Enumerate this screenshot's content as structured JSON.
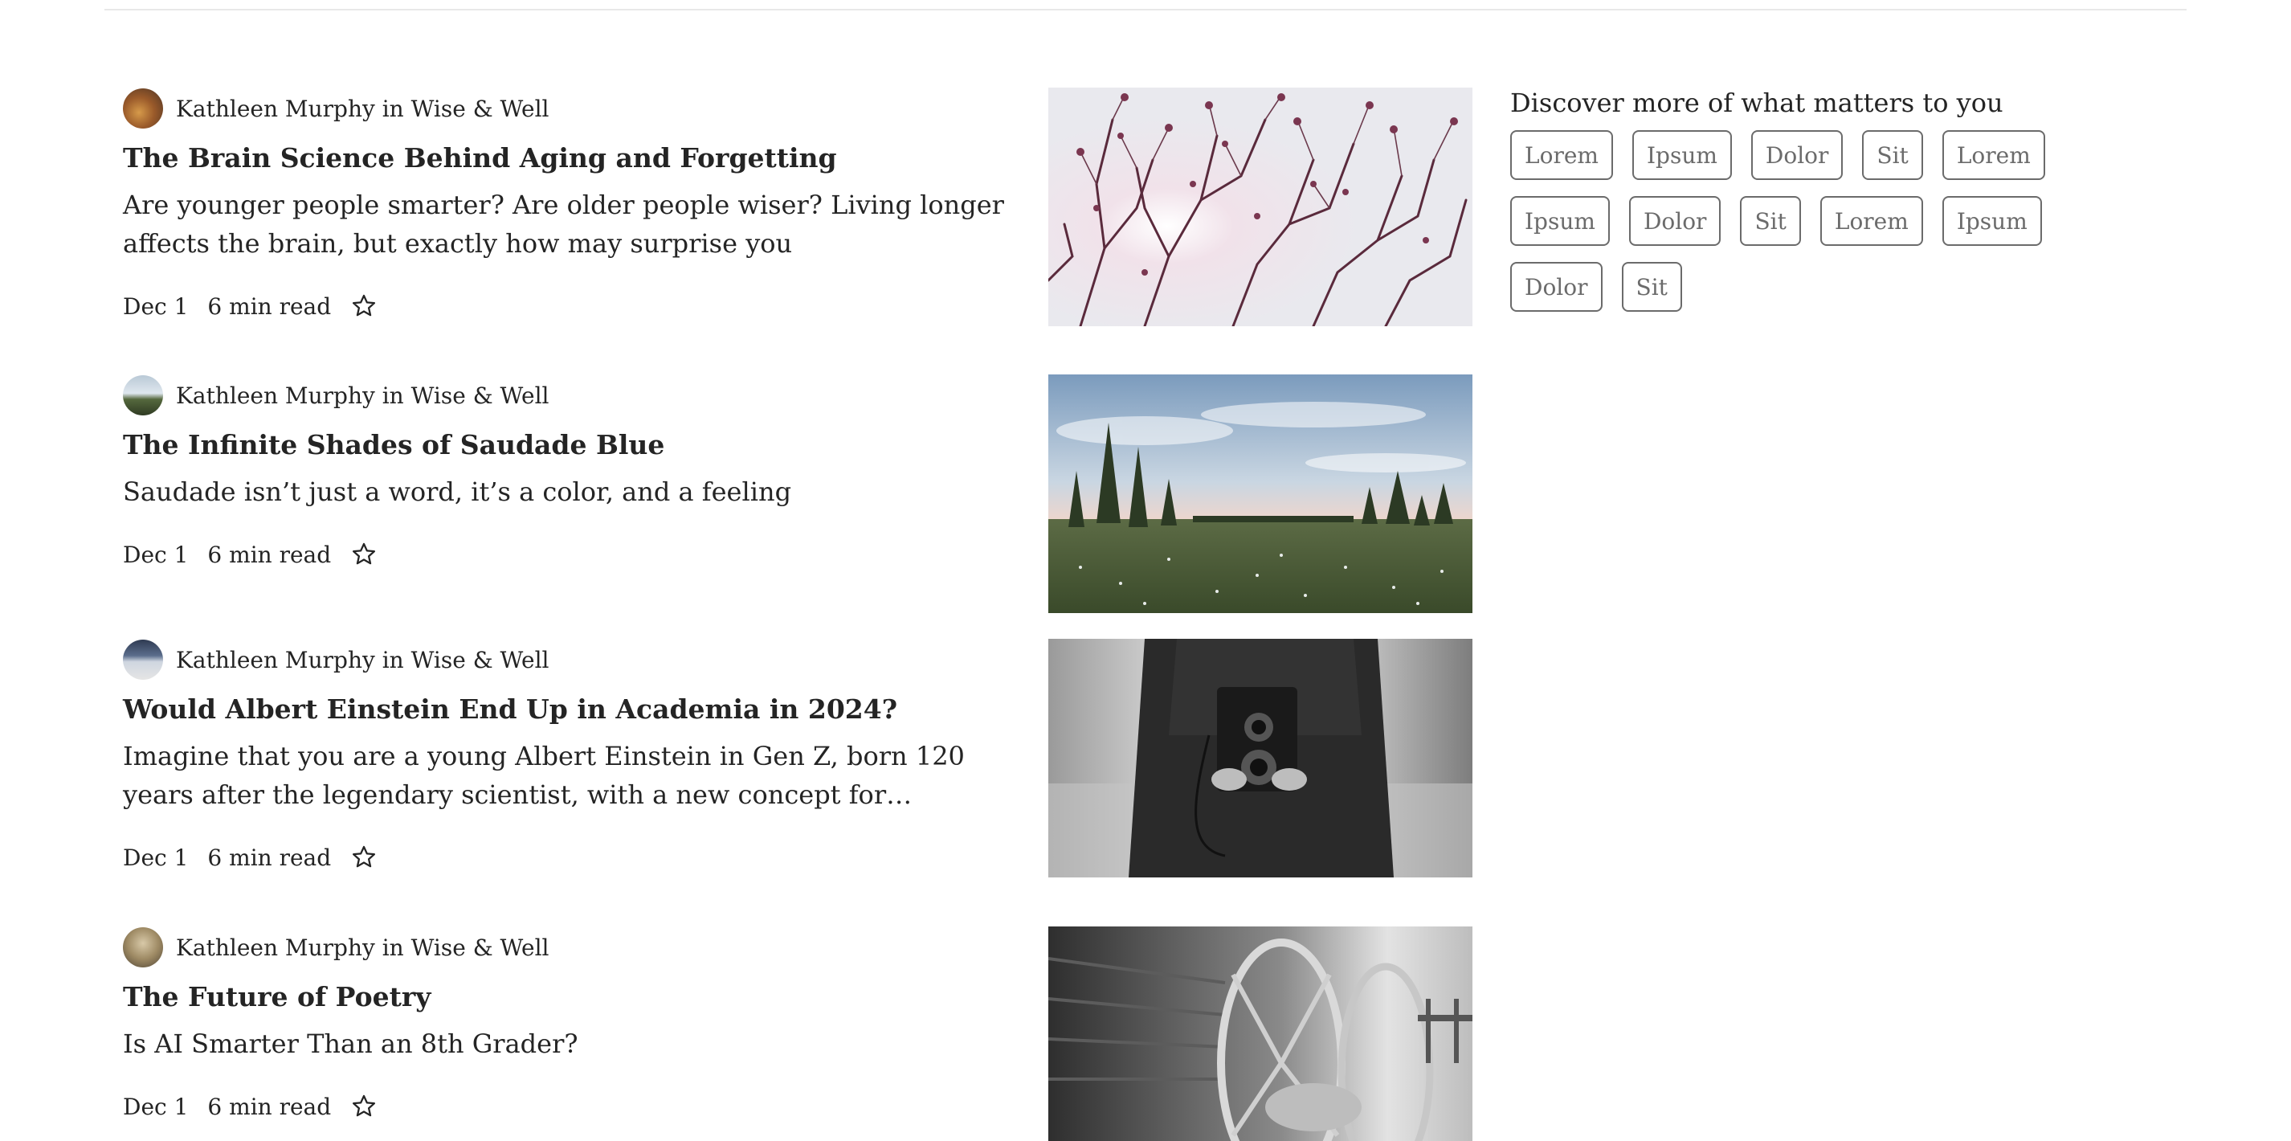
{
  "articles": [
    {
      "author": "Kathleen Murphy",
      "connector": "in",
      "publication": "Wise & Well",
      "title": "The Brain Science Behind Aging and Forgetting",
      "subtitle": "Are younger people smarter? Are older people wiser? Living longer affects the brain, but exactly how may surprise you",
      "date": "Dec 1",
      "read_time": "6 min read",
      "thumbnail": "pink-blossom-branches-against-sky"
    },
    {
      "author": "Kathleen Murphy",
      "connector": "in",
      "publication": "Wise & Well",
      "title": "The Infinite Shades of Saudade Blue",
      "subtitle": "Saudade isn’t just a word, it’s a color, and a feeling",
      "date": "Dec 1",
      "read_time": "6 min read",
      "thumbnail": "meadow-with-pine-trees"
    },
    {
      "author": "Kathleen Murphy",
      "connector": "in",
      "publication": "Wise & Well",
      "title": "Would Albert Einstein End Up in Academia in 2024?",
      "subtitle": "Imagine that you are a young Albert Einstein in Gen Z, born 120 years after the legendary scientist, with a new concept for…",
      "date": "Dec 1",
      "read_time": "6 min read",
      "thumbnail": "person-holding-vintage-camera"
    },
    {
      "author": "Kathleen Murphy",
      "connector": "in",
      "publication": "Wise & Well",
      "title": "The Future of Poetry",
      "subtitle": "Is AI Smarter Than an 8th Grader?",
      "date": "Dec 1",
      "read_time": "6 min read",
      "thumbnail": "old-wagon-wheel-black-and-white"
    }
  ],
  "sidebar": {
    "heading": "Discover more of what matters to you",
    "topics": [
      "Lorem",
      "Ipsum",
      "Dolor",
      "Sit",
      "Lorem",
      "Ipsum",
      "Dolor",
      "Sit",
      "Lorem",
      "Ipsum",
      "Dolor",
      "Sit"
    ]
  },
  "icons": {
    "bookmark": "star-icon"
  }
}
